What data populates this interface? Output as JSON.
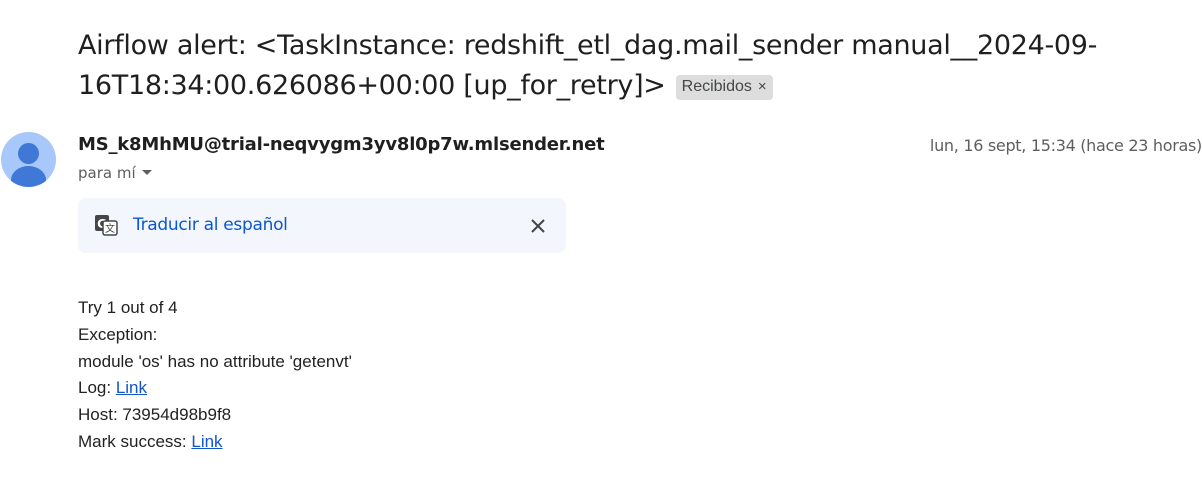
{
  "email": {
    "subject": "Airflow alert: <TaskInstance: redshift_etl_dag.mail_sender manual__2024-09-16T18:34:00.626086+00:00 [up_for_retry]>",
    "label": "Recibidos",
    "label_close": "×",
    "sender": "MS_k8MhMU@trial-neqvygm3yv8l0p7w.mlsender.net",
    "date": "lun, 16 sept, 15:34 (hace 23 horas)",
    "recipient": "para mí"
  },
  "translate": {
    "link": "Traducir al español",
    "icon": "translate-icon",
    "close_icon": "close-icon"
  },
  "body": {
    "try_line": "Try 1 out of 4",
    "exception_label": "Exception:",
    "exception_text": "module 'os' has no attribute 'getenvt'",
    "log_label": "Log: ",
    "log_link": "Link",
    "host_line": "Host: 73954d98b9f8",
    "mark_label": "Mark success: ",
    "mark_link": "Link"
  },
  "colors": {
    "link": "#0b57d0",
    "body_link": "#1155cc",
    "avatar_bg": "#a8c7fa",
    "avatar_fg": "#3f78d6",
    "translate_bg": "#f3f6fc"
  }
}
